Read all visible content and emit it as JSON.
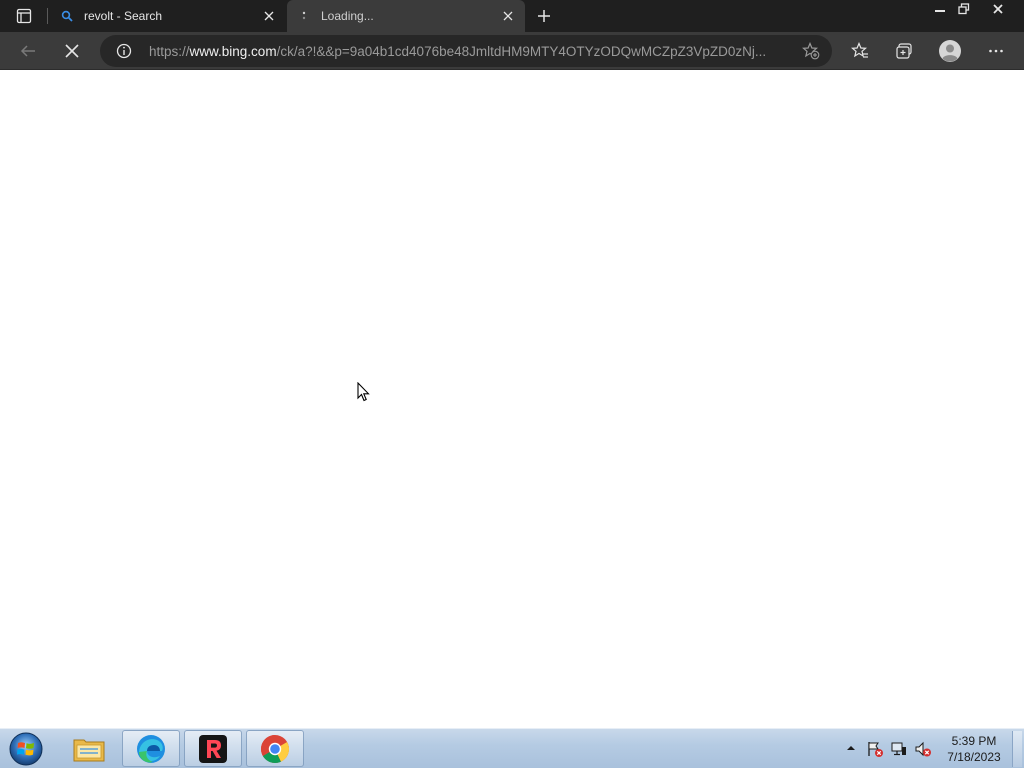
{
  "browser": {
    "tabs": [
      {
        "title": "revolt - Search",
        "favicon": "search-icon",
        "active": false
      },
      {
        "title": "Loading...",
        "favicon": "loading-spinner-icon",
        "active": true
      }
    ],
    "address": {
      "scheme": "https://",
      "host": "www.bing.com",
      "path": "/ck/a?!&&p=9a04b1cd4076be48JmltdHM9MTY4OTYzODQwMCZpZ3VpZD0zNj..."
    },
    "colors": {
      "tabbar": "#1f1f1f",
      "toolbar": "#3b3b3b",
      "address_bg": "#272727"
    }
  },
  "taskbar": {
    "apps": [
      {
        "name": "File Explorer",
        "icon": "folder-icon"
      },
      {
        "name": "Microsoft Edge",
        "icon": "edge-icon"
      },
      {
        "name": "Revolt",
        "icon": "revolt-icon"
      },
      {
        "name": "Google Chrome",
        "icon": "chrome-icon"
      }
    ],
    "clock": {
      "time": "5:39 PM",
      "date": "7/18/2023"
    }
  }
}
